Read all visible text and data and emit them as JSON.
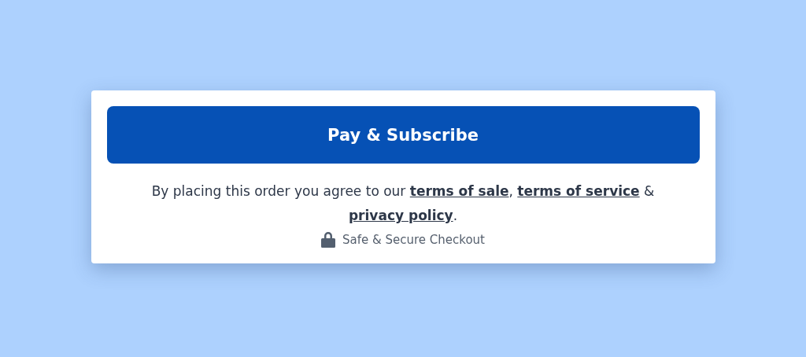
{
  "button": {
    "label": "Pay & Subscribe"
  },
  "agreement": [
    {
      "kind": "text",
      "text": "By placing this order you agree to our "
    },
    {
      "kind": "link",
      "text": "terms of sale"
    },
    {
      "kind": "text",
      "text": ", "
    },
    {
      "kind": "link",
      "text": "terms of service"
    },
    {
      "kind": "text",
      "text": " & "
    },
    {
      "kind": "link",
      "text": "privacy policy"
    },
    {
      "kind": "text",
      "text": "."
    }
  ],
  "secure_note": "Safe & Secure Checkout"
}
